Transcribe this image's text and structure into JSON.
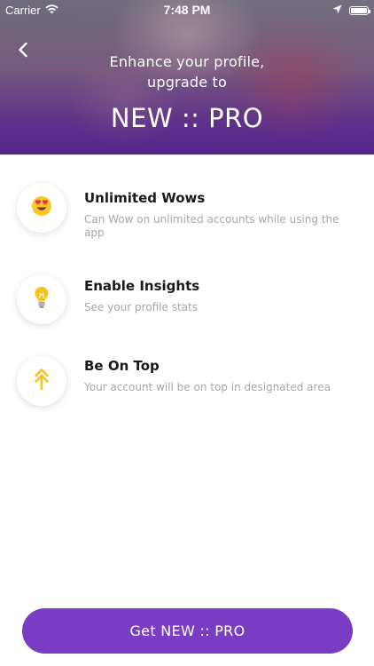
{
  "status_bar": {
    "carrier": "Carrier",
    "time": "7:48 PM",
    "battery_level": 1.0
  },
  "header": {
    "subtitle_line1": "Enhance your profile,",
    "subtitle_line2": "upgrade to",
    "title": "NEW :: PRO"
  },
  "features": [
    {
      "icon": "heart-eyes-emoji-icon",
      "title": "Unlimited Wows",
      "description": "Can Wow on unlimited accounts while using the app"
    },
    {
      "icon": "lightbulb-icon",
      "title": "Enable Insights",
      "description": "See your profile stats"
    },
    {
      "icon": "double-up-arrow-icon",
      "title": "Be On Top",
      "description": "Your account will be on top in designated area"
    }
  ],
  "cta": {
    "label": "Get NEW :: PRO"
  },
  "colors": {
    "accent": "#7a3cc3",
    "icon_yellow": "#f6c21c",
    "title_text": "#1a1a1a",
    "description_text": "#a7a7a7"
  }
}
